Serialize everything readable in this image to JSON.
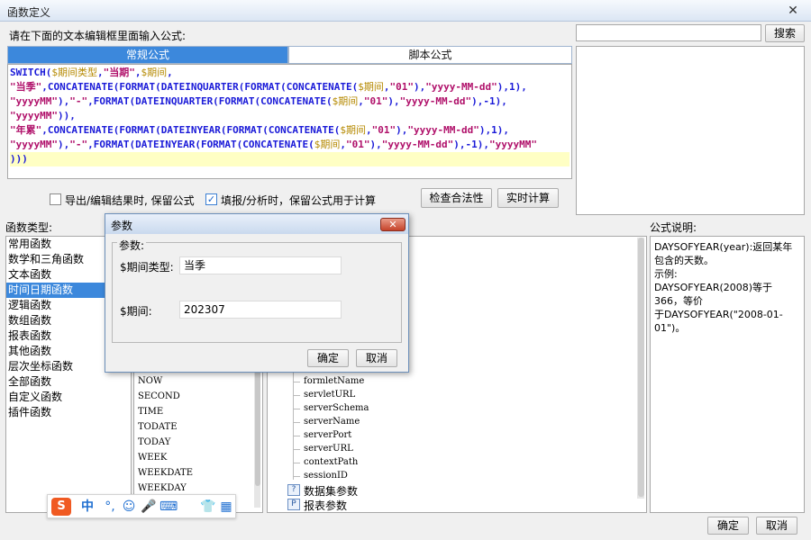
{
  "window": {
    "title": "函数定义",
    "close_glyph": "✕"
  },
  "instruction": "请在下面的文本编辑框里面输入公式:",
  "tabs": {
    "regular": "常规公式",
    "script": "脚本公式"
  },
  "editor": {
    "lines": [
      [
        {
          "t": "kw",
          "v": "SWITCH("
        },
        {
          "t": "var",
          "v": "$期间类型"
        },
        {
          "t": "op",
          "v": ","
        },
        {
          "t": "str",
          "v": "\"当期\""
        },
        {
          "t": "op",
          "v": ","
        },
        {
          "t": "var",
          "v": "$期间"
        },
        {
          "t": "op",
          "v": ","
        }
      ],
      [
        {
          "t": "str",
          "v": "\"当季\""
        },
        {
          "t": "op",
          "v": ","
        },
        {
          "t": "kw",
          "v": "CONCATENATE(FORMAT(DATEINQUARTER(FORMAT(CONCATENATE("
        },
        {
          "t": "var",
          "v": "$期间"
        },
        {
          "t": "op",
          "v": ","
        },
        {
          "t": "str",
          "v": "\"01\""
        },
        {
          "t": "op",
          "v": "),"
        },
        {
          "t": "str",
          "v": "\"yyyy-MM-dd\""
        },
        {
          "t": "op",
          "v": "),1),"
        }
      ],
      [
        {
          "t": "str",
          "v": "\"yyyyMM\""
        },
        {
          "t": "op",
          "v": "),"
        },
        {
          "t": "str",
          "v": "\"-\""
        },
        {
          "t": "op",
          "v": ","
        },
        {
          "t": "kw",
          "v": "FORMAT(DATEINQUARTER(FORMAT(CONCATENATE("
        },
        {
          "t": "var",
          "v": "$期间"
        },
        {
          "t": "op",
          "v": ","
        },
        {
          "t": "str",
          "v": "\"01\""
        },
        {
          "t": "op",
          "v": "),"
        },
        {
          "t": "str",
          "v": "\"yyyy-MM-dd\""
        },
        {
          "t": "op",
          "v": "),-1),"
        }
      ],
      [
        {
          "t": "str",
          "v": "\"yyyyMM\""
        },
        {
          "t": "op",
          "v": ")),"
        }
      ],
      [
        {
          "t": "str",
          "v": "\"年累\""
        },
        {
          "t": "op",
          "v": ","
        },
        {
          "t": "kw",
          "v": "CONCATENATE(FORMAT(DATEINYEAR(FORMAT(CONCATENATE("
        },
        {
          "t": "var",
          "v": "$期间"
        },
        {
          "t": "op",
          "v": ","
        },
        {
          "t": "str",
          "v": "\"01\""
        },
        {
          "t": "op",
          "v": "),"
        },
        {
          "t": "str",
          "v": "\"yyyy-MM-dd\""
        },
        {
          "t": "op",
          "v": "),1),"
        }
      ],
      [
        {
          "t": "str",
          "v": "\"yyyyMM\""
        },
        {
          "t": "op",
          "v": "),"
        },
        {
          "t": "str",
          "v": "\"-\""
        },
        {
          "t": "op",
          "v": ","
        },
        {
          "t": "kw",
          "v": "FORMAT(DATEINYEAR(FORMAT(CONCATENATE("
        },
        {
          "t": "var",
          "v": "$期间"
        },
        {
          "t": "op",
          "v": ","
        },
        {
          "t": "str",
          "v": "\"01\""
        },
        {
          "t": "op",
          "v": "),"
        },
        {
          "t": "str",
          "v": "\"yyyy-MM-dd\""
        },
        {
          "t": "op",
          "v": "),-1),"
        },
        {
          "t": "str",
          "v": "\"yyyyMM\""
        }
      ],
      [
        {
          "t": "op",
          "v": ")))"
        }
      ]
    ]
  },
  "search": {
    "button": "搜索",
    "placeholder": ""
  },
  "options": {
    "export_keep": "导出/编辑结果时, 保留公式",
    "fill_keep": "填报/分析时，保留公式用于计算",
    "fill_checked_glyph": "✓"
  },
  "buttons": {
    "check": "检查合法性",
    "realtime": "实时计算",
    "ok": "确定",
    "cancel": "取消"
  },
  "labels": {
    "function_type": "函数类型:",
    "formula_desc": "公式说明:"
  },
  "categories": [
    "常用函数",
    "数学和三角函数",
    "文本函数",
    "时间日期函数",
    "逻辑函数",
    "数组函数",
    "报表函数",
    "其他函数",
    "层次坐标函数",
    "全部函数",
    "自定义函数",
    "插件函数"
  ],
  "selected_category": 3,
  "functions": [
    "NOW",
    "SECOND",
    "TIME",
    "TODATE",
    "TODAY",
    "WEEK",
    "WEEKDATE",
    "WEEKDAY"
  ],
  "tree": {
    "items": [
      "formletName",
      "servletURL",
      "serverSchema",
      "serverName",
      "serverPort",
      "serverURL",
      "contextPath",
      "sessionID"
    ],
    "dataset_params": "数据集参数",
    "report_params": "报表参数",
    "dataset_icon_glyph": "?",
    "report_icon_glyph": "P"
  },
  "description": "DAYSOFYEAR(year):返回某年包含的天数。\n示例:\nDAYSOFYEAR(2008)等于366，等价\n于DAYSOFYEAR(\"2008-01-01\")。",
  "dialog": {
    "title": "参数",
    "close_glyph": "✕",
    "group_label": "参数:",
    "period_type_label": "$期间类型:",
    "period_type_value": "当季",
    "period_label": "$期间:",
    "period_value": "202307",
    "ok": "确定",
    "cancel": "取消"
  },
  "ime": {
    "logo": "S",
    "lang": "中",
    "punct": "°,",
    "emoji": "☺",
    "voice": "🎤",
    "keyboard": "⌨",
    "skin": "👕",
    "apps": "▦"
  }
}
